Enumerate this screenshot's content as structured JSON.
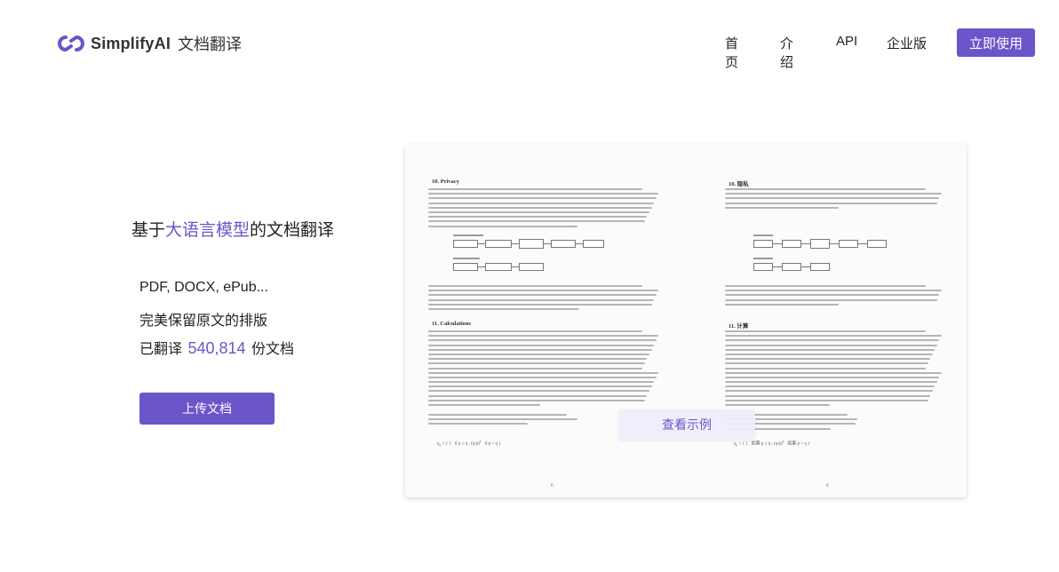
{
  "header": {
    "brand": "SimplifyAI",
    "product": "文档翻译",
    "nav": [
      "首页",
      "介绍",
      "API",
      "企业版"
    ],
    "cta_label": "立即使用"
  },
  "hero": {
    "headline_prefix": "基于",
    "headline_highlight": "大语言模型",
    "headline_suffix": "的文档翻译",
    "formats": "PDF, DOCX, ePub...",
    "layout_note": "完美保留原文的排版",
    "translated_prefix": "已翻译",
    "translated_count": "540,814",
    "translated_suffix": "份文档",
    "upload_label": "上传文档"
  },
  "preview": {
    "left_page": {
      "section1_title": "10.  Privacy",
      "section2_title": "11.  Calculations",
      "page_number": "6"
    },
    "right_page": {
      "section1_title": "10. 隐私",
      "section2_title": "11. 计算",
      "page_number": "6"
    },
    "example_label": "查看示例"
  },
  "colors": {
    "accent": "#6b55c9",
    "text": "#222222",
    "card_bg": "#fbfbfb"
  }
}
